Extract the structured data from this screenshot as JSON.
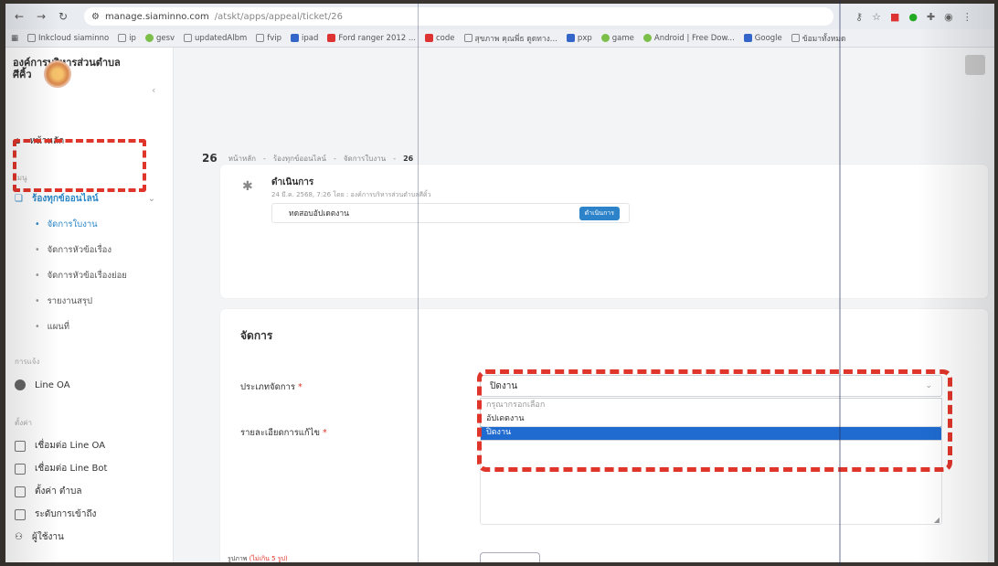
{
  "browser": {
    "url_host": "manage.siaminno.com",
    "url_path": "/atskt/apps/appeal/ticket/26",
    "bookmarks": [
      "Inkcloud siaminno",
      "ip",
      "gesv",
      "updatedAlbm",
      "fvip",
      "ipad",
      "Ford ranger 2012 ...",
      "code",
      "สุขภาพ คุณพี่ธ ดูดทาง...",
      "pxp",
      "game",
      "Android | Free Dow...",
      "Google",
      "ข้อมาทั้งหมด"
    ]
  },
  "sidebar": {
    "org_name_line1": "องค์การบริหารส่วนตำบล",
    "org_name_line2": "ศีคิ้ว",
    "home": "หน้าหลัก",
    "section_main": "เมนู",
    "complaints": "ร้องทุกข์ออนไลน์",
    "sub_items": [
      "จัดการใบงาน",
      "จัดการหัวข้อเรื่อง",
      "จัดการหัวข้อเรื่องย่อย",
      "รายงานสรุป",
      "แผนที่"
    ],
    "section_line": "การแจ้ง",
    "line_oa": "Line OA",
    "section_settings": "ตั้งค่า",
    "settings_items": [
      "เชื่อมต่อ Line OA",
      "เชื่อมต่อ Line Bot",
      "ตั้งค่า ตำบล",
      "ระดับการเข้าถึง",
      "ผู้ใช้งาน"
    ]
  },
  "breadcrumb": {
    "id": "26",
    "items": [
      "หน้าหลัก",
      "ร้องทุกข์ออนไลน์",
      "จัดการใบงาน",
      "26"
    ]
  },
  "status_card": {
    "title": "ดำเนินการ",
    "meta": "24 มี.ค. 2568, 7:26 โดย : องค์การบริหารส่วนตำบลศีคิ้ว",
    "description": "ทดสอบอัปเดตงาน",
    "badge": "ดำเนินการ"
  },
  "manage_form": {
    "title": "จัดการ",
    "type_label": "ประเภทจัดการ",
    "required_mark": "*",
    "selected_value": "ปิดงาน",
    "options": [
      "กรุณากรอกเลือก",
      "อัปเดตงาน",
      "ปิดงาน"
    ],
    "detail_label": "รายละเอียดการแก้ไข",
    "attachments_label": "รูปภาพ",
    "attachments_note": "(ไม่เกิน 5 รูป)"
  }
}
